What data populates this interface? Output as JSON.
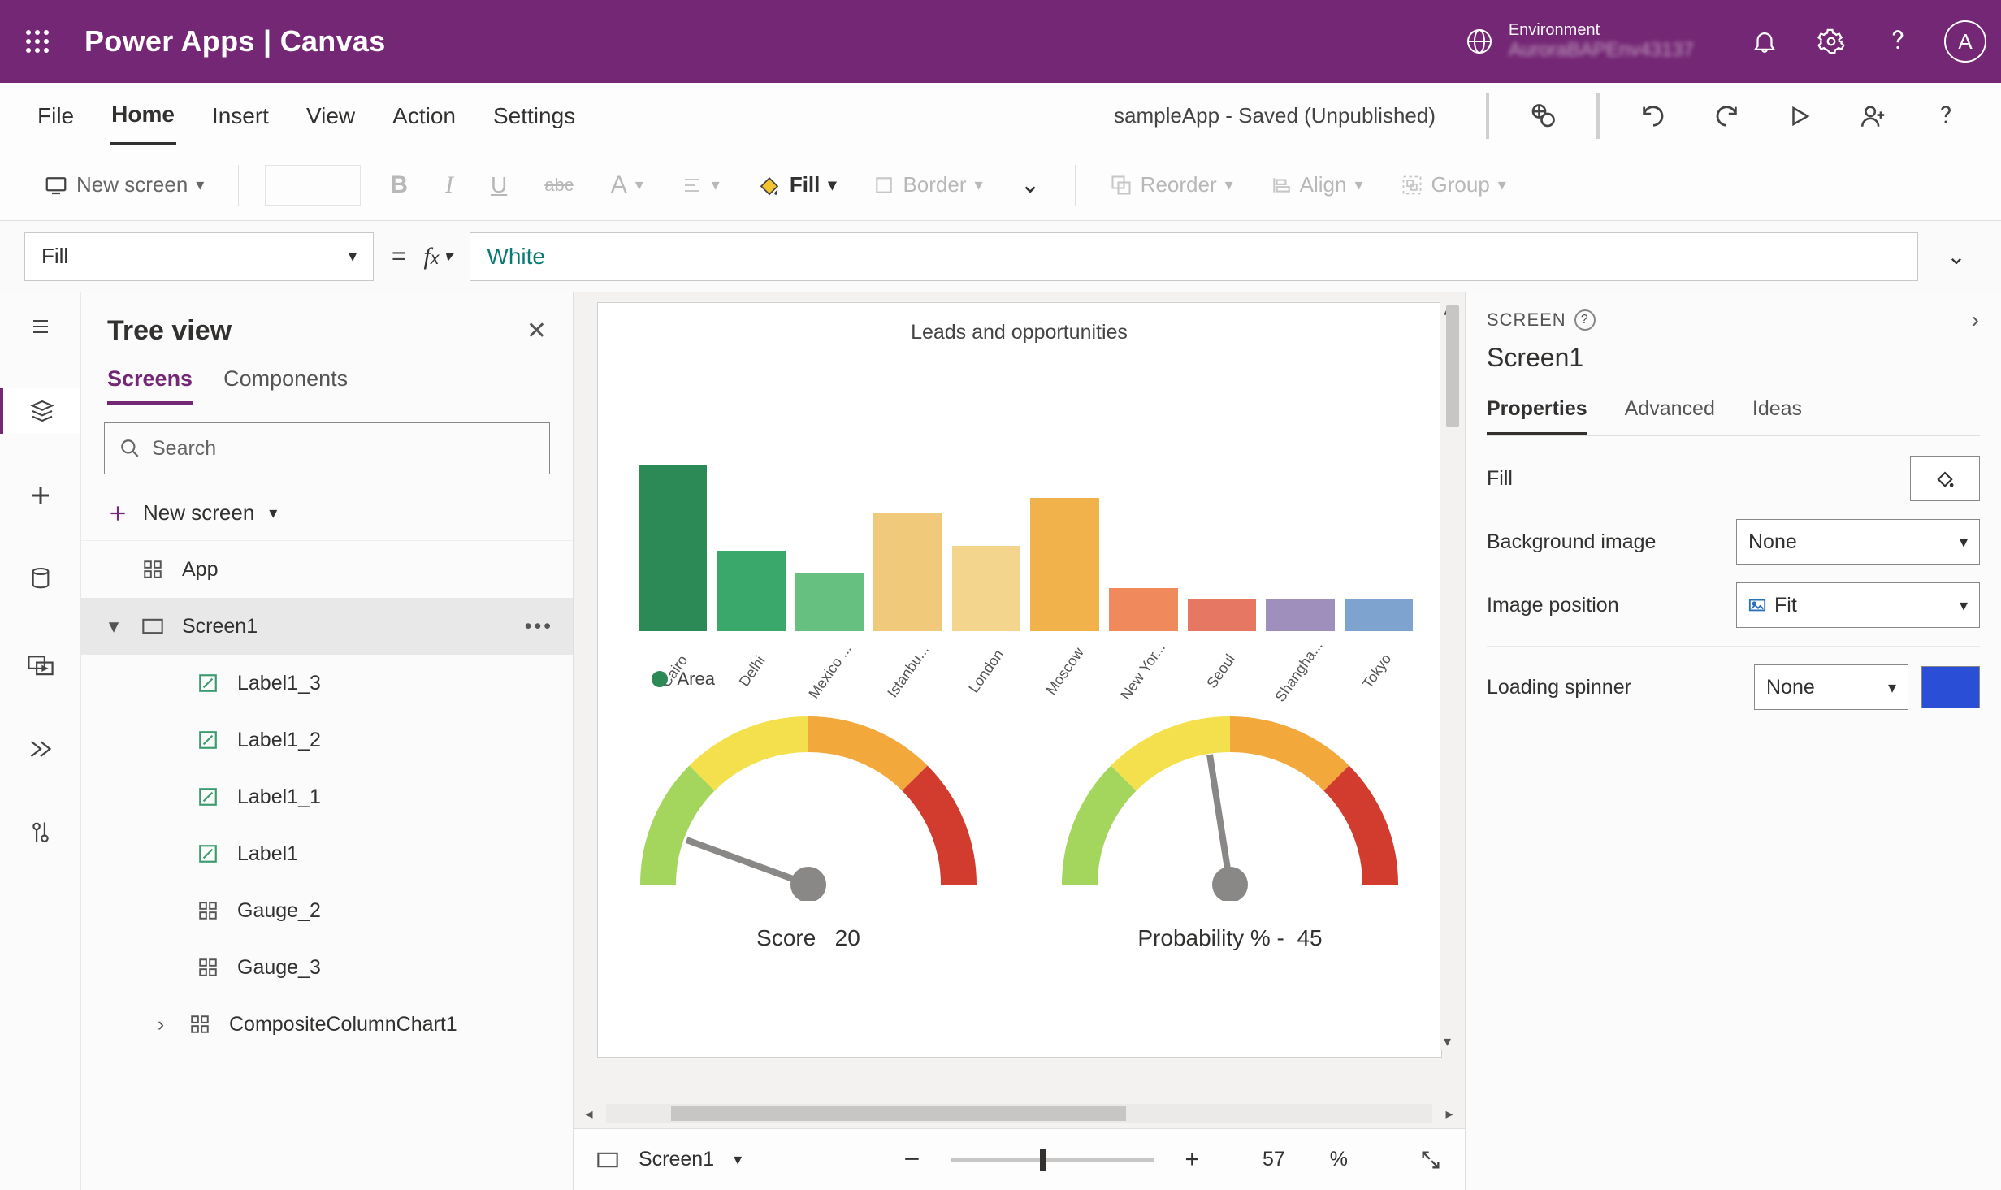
{
  "header": {
    "app_brand": "Power Apps",
    "app_separator": "  |  ",
    "app_mode": "Canvas",
    "env_label": "Environment",
    "env_name": "AuroraBAPEnv43137",
    "avatar_initial": "A"
  },
  "ribbon": {
    "tabs": [
      "File",
      "Home",
      "Insert",
      "View",
      "Action",
      "Settings"
    ],
    "active_tab": "Home",
    "status": "sampleApp - Saved (Unpublished)"
  },
  "toolbar": {
    "new_screen": "New screen",
    "fill": "Fill",
    "border": "Border",
    "reorder": "Reorder",
    "align": "Align",
    "group": "Group"
  },
  "formula": {
    "property": "Fill",
    "value": "White"
  },
  "tree": {
    "title": "Tree view",
    "tab_screens": "Screens",
    "tab_components": "Components",
    "search_placeholder": "Search",
    "new_screen": "New screen",
    "items": {
      "app": "App",
      "screen1": "Screen1",
      "label1_3": "Label1_3",
      "label1_2": "Label1_2",
      "label1_1": "Label1_1",
      "label1": "Label1",
      "gauge_2": "Gauge_2",
      "gauge_3": "Gauge_3",
      "composite": "CompositeColumnChart1"
    }
  },
  "canvas": {
    "chart_title": "Leads and opportunities",
    "legend": "Area",
    "gauge1_label": "Score",
    "gauge1_value": "20",
    "gauge2_label": "Probability % -",
    "gauge2_value": "45",
    "footer_screen": "Screen1",
    "zoom_value": "57",
    "zoom_pct": "%"
  },
  "chart_data": {
    "type": "bar",
    "title": "Leads and opportunities",
    "legend": [
      "Area"
    ],
    "categories": [
      "Cairo",
      "Delhi",
      "Mexico ...",
      "Istanbu...",
      "London",
      "Moscow",
      "New Yor...",
      "Seoul",
      "Shangha...",
      "Tokyo"
    ],
    "values": [
      31,
      15,
      11,
      22,
      16,
      25,
      8,
      6,
      6,
      6
    ],
    "colors": [
      "#2c8a57",
      "#3ba86b",
      "#66c07f",
      "#f0c97a",
      "#f4d58d",
      "#f2b24b",
      "#f08a5d",
      "#e57763",
      "#9e8fbd",
      "#7ea3cf"
    ],
    "ylim": [
      0,
      35
    ],
    "xlabel": "",
    "ylabel": ""
  },
  "props": {
    "screen_cap": "SCREEN",
    "screen_name": "Screen1",
    "tab_properties": "Properties",
    "tab_advanced": "Advanced",
    "tab_ideas": "Ideas",
    "fill": "Fill",
    "bgimage": "Background image",
    "bgimage_val": "None",
    "imgpos": "Image position",
    "imgpos_val": "Fit",
    "spinner": "Loading spinner",
    "spinner_val": "None",
    "swatch_color": "#2a4fd6"
  }
}
